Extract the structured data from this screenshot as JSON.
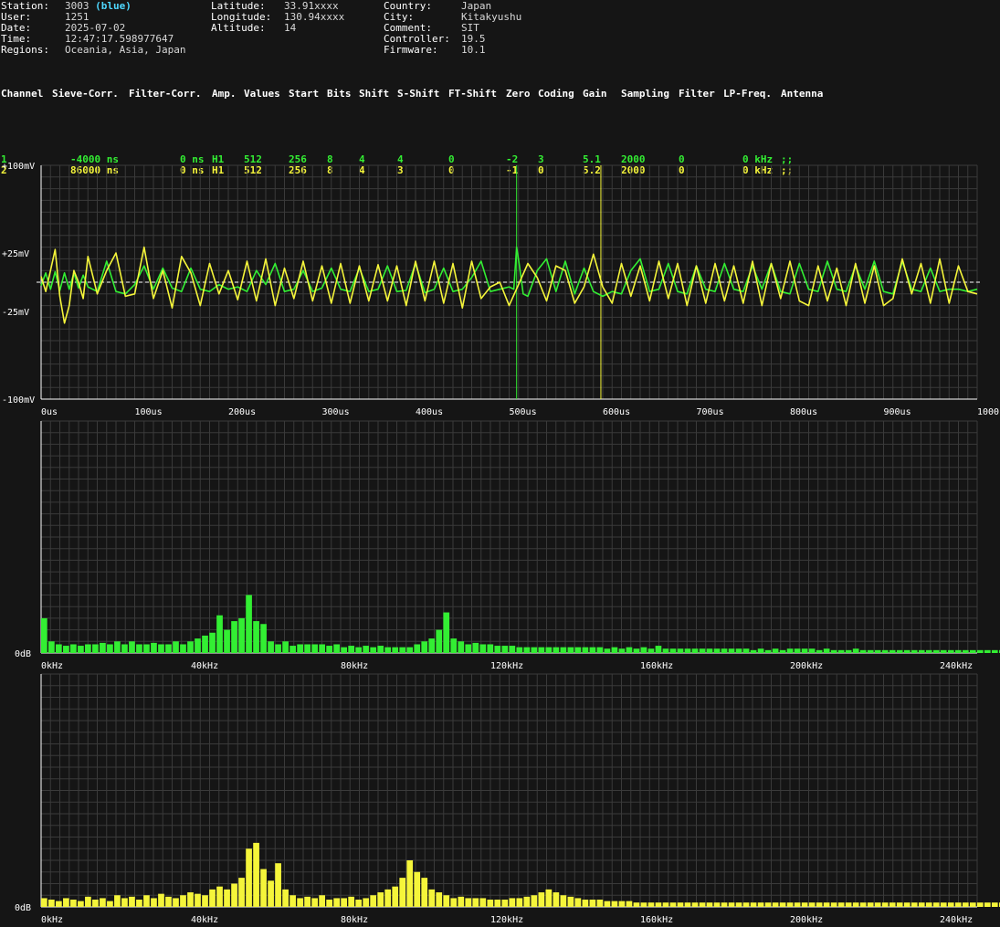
{
  "info": {
    "col1": [
      {
        "key": "Station:",
        "value": "3003",
        "extra": "(blue)"
      },
      {
        "key": "User:",
        "value": "1251"
      },
      {
        "key": "Date:",
        "value": "2025-07-02"
      },
      {
        "key": "Time:",
        "value": "12:47:17.598977647"
      },
      {
        "key": "Regions:",
        "value": "Oceania, Asia, Japan"
      }
    ],
    "col2": [
      {
        "key": "Latitude:",
        "value": "33.91xxxx"
      },
      {
        "key": "Longitude:",
        "value": "130.94xxxx"
      },
      {
        "key": "Altitude:",
        "value": "14"
      }
    ],
    "col3": [
      {
        "key": "Country:",
        "value": "Japan"
      },
      {
        "key": "City:",
        "value": "Kitakyushu"
      },
      {
        "key": "Comment:",
        "value": "SIT"
      },
      {
        "key": "Controller:",
        "value": "19.5"
      },
      {
        "key": "Firmware:",
        "value": "10.1"
      }
    ]
  },
  "channel_table": {
    "headers": [
      "Channel",
      "Sieve-Corr.",
      "Filter-Corr.",
      "Amp.",
      "Values",
      "Start",
      "Bits",
      "Shift",
      "S-Shift",
      "FT-Shift",
      "Zero",
      "Coding",
      "Gain",
      "Sampling",
      "Filter",
      "LP-Freq.",
      "Antenna"
    ],
    "rows": [
      {
        "color": "#33ee33",
        "cells": [
          "1",
          "-4000 ns",
          "0 ns",
          "H1",
          "512",
          "256",
          "8",
          "4",
          "4",
          "0",
          "-2",
          "3",
          "5.1",
          "2000",
          "0",
          "0 kHz",
          ";;"
        ]
      },
      {
        "color": "#f5f53a",
        "cells": [
          "2",
          "86000 ns",
          "0 ns",
          "H1",
          "512",
          "256",
          "8",
          "4",
          "3",
          "0",
          "-1",
          "0",
          "5.2",
          "2000",
          "0",
          "0 kHz",
          ";;"
        ]
      }
    ]
  },
  "colors": {
    "background": "#151515",
    "grid": "#3a3a3a",
    "axis": "#ffffff",
    "zero_line": "#ffffff",
    "channel1": "#33ee33",
    "channel2": "#f5f53a",
    "station_highlight": "#4fd8ff"
  },
  "chart_data": [
    {
      "type": "line",
      "x_unit": "us",
      "xlim": [
        0,
        1000
      ],
      "ylim": [
        -100,
        100
      ],
      "y_unit": "mV",
      "x_tick_labels": [
        "0us",
        "100us",
        "200us",
        "300us",
        "400us",
        "500us",
        "600us",
        "700us",
        "800us",
        "900us",
        "1000us"
      ],
      "y_tick_labels": [
        {
          "value": 100,
          "label": "+100mV"
        },
        {
          "value": 25,
          "label": "+25mV"
        },
        {
          "value": -25,
          "label": "-25mV"
        },
        {
          "value": -100,
          "label": "-100mV"
        }
      ],
      "grid": true,
      "markers": [
        {
          "x": 508,
          "color": "#33ee33"
        },
        {
          "x": 598,
          "color": "#f5f53a"
        }
      ],
      "series": [
        {
          "color": "#33ee33",
          "x": [
            0,
            5,
            10,
            15,
            20,
            25,
            30,
            35,
            40,
            45,
            50,
            60,
            70,
            80,
            90,
            100,
            110,
            120,
            130,
            140,
            150,
            160,
            170,
            180,
            190,
            200,
            210,
            220,
            230,
            240,
            250,
            260,
            270,
            280,
            290,
            300,
            310,
            320,
            330,
            340,
            350,
            360,
            370,
            380,
            390,
            400,
            410,
            420,
            430,
            440,
            450,
            460,
            470,
            480,
            490,
            500,
            505,
            508,
            511,
            515,
            520,
            530,
            540,
            550,
            560,
            570,
            580,
            590,
            600,
            610,
            620,
            630,
            640,
            650,
            660,
            670,
            680,
            690,
            700,
            710,
            720,
            730,
            740,
            750,
            760,
            770,
            780,
            790,
            800,
            810,
            820,
            830,
            840,
            850,
            860,
            870,
            880,
            890,
            900,
            910,
            920,
            930,
            940,
            950,
            960,
            970,
            980,
            990,
            1000
          ],
          "y": [
            -3,
            8,
            -6,
            9,
            -7,
            8,
            -6,
            8,
            -5,
            6,
            -4,
            -8,
            18,
            -8,
            -10,
            -2,
            14,
            -6,
            12,
            -5,
            -8,
            12,
            -6,
            -8,
            -2,
            -6,
            -4,
            -8,
            10,
            -2,
            16,
            -8,
            -6,
            10,
            -8,
            -5,
            12,
            -6,
            -8,
            12,
            -8,
            -6,
            14,
            -8,
            -7,
            16,
            -9,
            -6,
            12,
            -8,
            -6,
            4,
            18,
            -8,
            -6,
            -4,
            -6,
            30,
            14,
            -10,
            -12,
            10,
            20,
            -8,
            18,
            -10,
            12,
            -8,
            -12,
            -8,
            -10,
            10,
            20,
            -8,
            -6,
            16,
            -8,
            -10,
            14,
            -6,
            -8,
            16,
            -6,
            -8,
            14,
            -6,
            16,
            -8,
            -10,
            16,
            -6,
            -8,
            18,
            -6,
            -8,
            14,
            -6,
            18,
            -8,
            -10,
            18,
            -6,
            -8,
            12,
            -8,
            -6,
            -6,
            -8,
            -6
          ]
        },
        {
          "color": "#f5f53a",
          "x": [
            0,
            5,
            10,
            15,
            20,
            25,
            30,
            35,
            40,
            45,
            50,
            60,
            70,
            80,
            90,
            100,
            110,
            120,
            130,
            140,
            150,
            160,
            170,
            180,
            190,
            200,
            210,
            220,
            230,
            240,
            250,
            260,
            270,
            280,
            290,
            300,
            310,
            320,
            330,
            340,
            350,
            360,
            370,
            380,
            390,
            400,
            410,
            420,
            430,
            440,
            450,
            460,
            470,
            480,
            490,
            500,
            510,
            520,
            530,
            540,
            550,
            560,
            570,
            580,
            590,
            600,
            610,
            620,
            630,
            640,
            650,
            660,
            670,
            680,
            690,
            700,
            710,
            720,
            730,
            740,
            750,
            760,
            770,
            780,
            790,
            800,
            810,
            820,
            830,
            840,
            850,
            860,
            870,
            880,
            890,
            900,
            910,
            920,
            930,
            940,
            950,
            960,
            970,
            980,
            990,
            1000
          ],
          "y": [
            5,
            -8,
            10,
            28,
            -12,
            -35,
            -20,
            10,
            0,
            -14,
            22,
            -10,
            10,
            25,
            -12,
            -10,
            30,
            -14,
            10,
            -22,
            22,
            8,
            -20,
            16,
            -10,
            10,
            -15,
            18,
            -16,
            20,
            -20,
            12,
            -14,
            18,
            -16,
            14,
            -18,
            16,
            -18,
            14,
            -16,
            15,
            -16,
            14,
            -20,
            18,
            -16,
            18,
            -18,
            16,
            -22,
            18,
            -14,
            -4,
            0,
            -20,
            -2,
            16,
            4,
            -16,
            14,
            10,
            -18,
            -4,
            24,
            -4,
            -18,
            16,
            -12,
            14,
            -16,
            18,
            -14,
            16,
            -20,
            14,
            -18,
            16,
            -16,
            14,
            -18,
            18,
            -20,
            16,
            -14,
            18,
            -16,
            -20,
            14,
            -16,
            12,
            -20,
            16,
            -18,
            14,
            -20,
            -14,
            20,
            -10,
            16,
            -18,
            20,
            -18,
            14,
            -8,
            -10
          ]
        }
      ]
    },
    {
      "type": "bar",
      "color": "#33ee33",
      "x_unit": "kHz",
      "xlim": [
        0,
        250
      ],
      "bin_width": 1.953,
      "y_tick_labels": [
        {
          "value": 0,
          "label": "0dB"
        }
      ],
      "x_tick_labels": [
        "0kHz",
        "40kHz",
        "80kHz",
        "120kHz",
        "160kHz",
        "200kHz",
        "240kHz"
      ],
      "grid": true,
      "values": [
        24,
        8,
        6,
        5,
        6,
        5,
        6,
        6,
        7,
        6,
        8,
        6,
        8,
        6,
        6,
        7,
        6,
        6,
        8,
        6,
        8,
        10,
        12,
        14,
        26,
        16,
        22,
        24,
        40,
        22,
        20,
        8,
        6,
        8,
        5,
        6,
        6,
        6,
        6,
        5,
        6,
        4,
        5,
        4,
        5,
        4,
        5,
        4,
        4,
        4,
        4,
        6,
        8,
        10,
        16,
        28,
        10,
        8,
        6,
        7,
        6,
        6,
        5,
        5,
        5,
        4,
        4,
        4,
        4,
        4,
        4,
        4,
        4,
        4,
        4,
        4,
        4,
        3,
        4,
        3,
        4,
        3,
        4,
        3,
        5,
        3,
        3,
        3,
        3,
        3,
        3,
        3,
        3,
        3,
        3,
        3,
        3,
        2,
        3,
        2,
        3,
        2,
        3,
        3,
        3,
        3,
        2,
        3,
        2,
        2,
        2,
        3,
        2,
        2,
        2,
        2,
        2,
        2,
        2,
        2,
        2,
        2,
        2,
        2,
        2,
        2,
        2,
        2,
        2,
        2,
        2,
        2,
        2,
        2,
        2,
        2,
        2,
        2,
        2,
        2,
        2,
        2,
        2,
        2,
        2,
        2,
        2,
        2,
        2,
        2,
        2,
        2,
        2,
        2,
        2,
        2,
        2,
        2,
        2,
        2,
        2,
        2,
        2,
        2,
        2,
        2,
        2,
        2,
        2,
        2,
        2,
        2,
        2,
        2,
        2,
        2,
        2,
        2,
        2,
        2,
        2,
        2,
        2,
        2,
        2,
        3,
        2,
        2,
        3,
        2,
        2,
        3,
        2,
        3,
        2,
        3,
        2,
        3,
        3,
        2,
        3,
        3,
        3,
        2,
        3,
        3,
        3,
        3,
        3,
        3,
        3,
        3,
        3,
        3,
        3,
        3,
        3,
        3,
        3,
        3,
        3,
        3,
        3,
        3,
        3,
        3,
        3,
        3,
        3,
        3,
        3,
        3,
        3,
        3,
        3,
        4,
        3,
        3,
        4,
        3,
        4,
        4,
        4,
        4,
        4,
        4,
        4,
        5,
        5,
        5,
        5,
        5,
        6,
        6,
        6,
        6,
        6,
        6,
        6,
        7,
        7,
        7,
        7,
        7
      ]
    },
    {
      "type": "bar",
      "color": "#f5f53a",
      "x_unit": "kHz",
      "xlim": [
        0,
        250
      ],
      "bin_width": 1.953,
      "y_tick_labels": [
        {
          "value": 0,
          "label": "0dB"
        }
      ],
      "x_tick_labels": [
        "0kHz",
        "40kHz",
        "80kHz",
        "120kHz",
        "160kHz",
        "200kHz",
        "240kHz"
      ],
      "grid": true,
      "values": [
        6,
        5,
        4,
        6,
        5,
        4,
        7,
        5,
        6,
        4,
        8,
        6,
        7,
        5,
        8,
        6,
        9,
        7,
        6,
        8,
        10,
        9,
        8,
        12,
        14,
        12,
        16,
        20,
        40,
        44,
        26,
        18,
        30,
        12,
        8,
        6,
        7,
        6,
        8,
        5,
        6,
        6,
        7,
        5,
        6,
        8,
        10,
        12,
        14,
        20,
        32,
        24,
        20,
        12,
        10,
        8,
        6,
        7,
        6,
        6,
        6,
        5,
        5,
        5,
        6,
        6,
        7,
        8,
        10,
        12,
        10,
        8,
        7,
        6,
        5,
        5,
        5,
        4,
        4,
        4,
        4,
        3,
        3,
        3,
        3,
        3,
        3,
        3,
        3,
        3,
        3,
        3,
        3,
        3,
        3,
        3,
        3,
        3,
        3,
        3,
        3,
        3,
        3,
        3,
        3,
        3,
        3,
        3,
        3,
        3,
        3,
        3,
        3,
        3,
        3,
        3,
        3,
        3,
        3,
        3,
        3,
        3,
        3,
        3,
        3,
        3,
        3,
        3,
        3,
        3,
        3,
        3,
        4,
        3,
        3,
        3,
        3,
        3,
        3,
        3,
        3,
        3,
        3,
        3,
        3,
        3,
        3,
        3,
        3,
        3,
        3,
        3,
        3,
        3,
        3,
        3,
        3,
        3,
        3,
        3,
        3,
        3,
        3,
        3,
        3,
        3,
        3,
        3,
        3,
        3,
        3,
        3,
        3,
        3,
        3,
        3,
        3,
        3,
        3,
        3,
        3,
        3,
        3,
        3,
        3,
        3,
        3,
        3,
        3,
        3,
        3,
        3,
        3,
        3,
        3,
        3,
        3,
        3,
        3,
        3,
        3,
        3,
        3,
        3,
        3,
        3,
        3,
        3,
        3,
        3,
        3,
        3,
        3,
        3,
        3,
        3,
        3,
        3,
        3,
        3,
        3,
        3,
        3,
        3,
        3,
        3,
        3,
        3,
        3,
        3,
        3,
        3,
        3,
        3,
        3,
        3,
        3,
        3,
        3,
        3,
        3,
        3,
        3,
        3,
        3,
        3,
        3,
        3,
        3,
        3,
        3,
        3,
        3,
        3,
        3,
        3,
        3
      ]
    }
  ]
}
